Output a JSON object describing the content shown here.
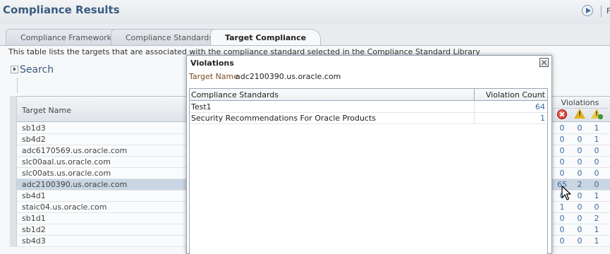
{
  "header": {
    "title": "Compliance Results",
    "trail_char": "F"
  },
  "tabs": [
    {
      "label": "Compliance Frameworks",
      "active": false
    },
    {
      "label": "Compliance Standards",
      "active": false
    },
    {
      "label": "Target Compliance",
      "active": true
    }
  ],
  "description": "This table lists the targets that are associated with the compliance standard selected in the Compliance Standard Library",
  "search": {
    "label": "Search"
  },
  "targets_table": {
    "column_target": "Target Name",
    "rows": [
      {
        "name": "sb1d3",
        "critical": "0",
        "warning": "0",
        "minor": "1",
        "selected": false
      },
      {
        "name": "sb4d2",
        "critical": "0",
        "warning": "0",
        "minor": "1",
        "selected": false
      },
      {
        "name": "adc6170569.us.oracle.com",
        "critical": "0",
        "warning": "0",
        "minor": "0",
        "selected": false
      },
      {
        "name": "slc00aal.us.oracle.com",
        "critical": "0",
        "warning": "0",
        "minor": "0",
        "selected": false
      },
      {
        "name": "slc00ats.us.oracle.com",
        "critical": "0",
        "warning": "0",
        "minor": "0",
        "selected": false
      },
      {
        "name": "adc2100390.us.oracle.com",
        "critical": "65",
        "warning": "2",
        "minor": "0",
        "selected": true
      },
      {
        "name": "sb4d1",
        "critical": "0",
        "warning": "0",
        "minor": "1",
        "selected": false
      },
      {
        "name": "staic04.us.oracle.com",
        "critical": "1",
        "warning": "0",
        "minor": "0",
        "selected": false
      },
      {
        "name": "sb1d1",
        "critical": "0",
        "warning": "0",
        "minor": "2",
        "selected": false
      },
      {
        "name": "sb1d2",
        "critical": "0",
        "warning": "0",
        "minor": "1",
        "selected": false
      },
      {
        "name": "sb4d3",
        "critical": "0",
        "warning": "0",
        "minor": "1",
        "selected": false
      }
    ]
  },
  "violations_column": {
    "title": "Violations",
    "icons": [
      "critical-icon",
      "warning-icon",
      "minor-warning-icon"
    ],
    "warn_glyph": "!"
  },
  "dialog": {
    "title": "Violations",
    "target_label": "Target Name",
    "target_value": "adc2100390.us.oracle.com",
    "col_standards": "Compliance Standards",
    "col_count": "Violation Count",
    "rows": [
      {
        "standard": "Test1",
        "count": "64"
      },
      {
        "standard": "Security Recommendations For Oracle Products",
        "count": "1"
      }
    ]
  },
  "colors": {
    "title_blue": "#3b5b80",
    "link_blue": "#3d6aa0",
    "selected_row": "#c9d5e2",
    "critical_red": "#c8231b",
    "warning_yellow": "#e3b21c"
  }
}
